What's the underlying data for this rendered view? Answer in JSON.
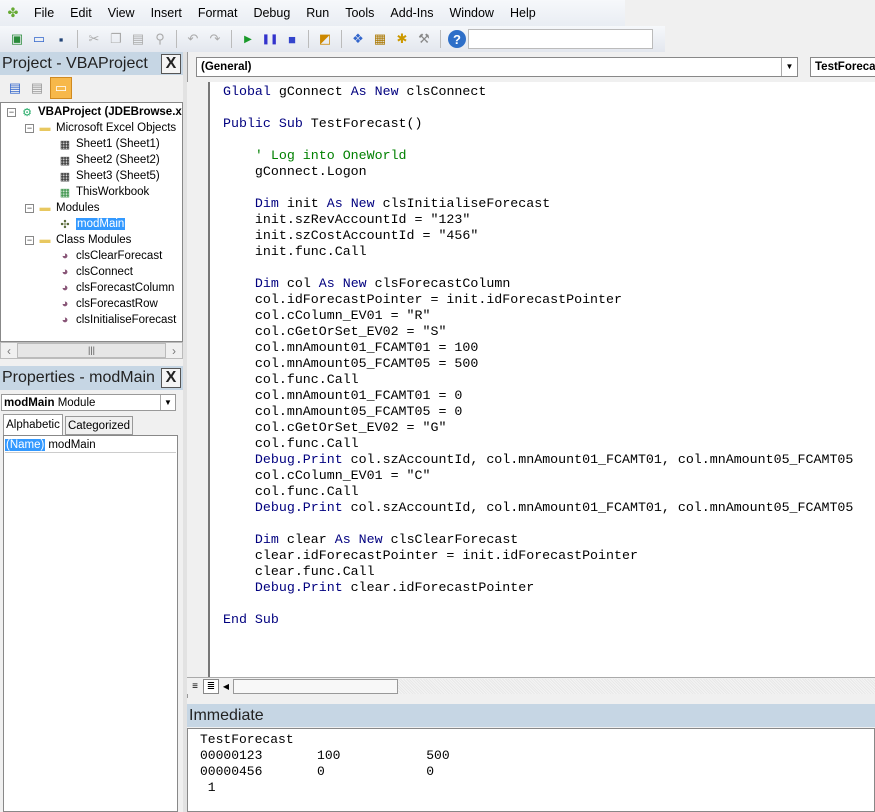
{
  "menu": [
    "File",
    "Edit",
    "View",
    "Insert",
    "Format",
    "Debug",
    "Run",
    "Tools",
    "Add-Ins",
    "Window",
    "Help"
  ],
  "toolbar_icons": [
    "excel-icon",
    "insert-userform-icon",
    "save-icon",
    "cut-icon",
    "copy-icon",
    "paste-icon",
    "find-icon",
    "undo-icon",
    "redo-icon",
    "run-icon",
    "break-icon",
    "reset-icon",
    "design-mode-icon",
    "project-explorer-icon",
    "properties-icon",
    "object-browser-icon",
    "toolbox-icon",
    "help-icon"
  ],
  "project": {
    "title": "Project - VBAProject",
    "close": "X",
    "tree": [
      {
        "label": "VBAProject (JDEBrowse.x",
        "level": 0,
        "icon": "vbaproject-icon",
        "bold": true
      },
      {
        "label": "Microsoft Excel Objects",
        "level": 1,
        "icon": "folder-icon"
      },
      {
        "label": "Sheet1 (Sheet1)",
        "level": 2,
        "icon": "sheet-icon"
      },
      {
        "label": "Sheet2 (Sheet2)",
        "level": 2,
        "icon": "sheet-icon"
      },
      {
        "label": "Sheet3 (Sheet5)",
        "level": 2,
        "icon": "sheet-icon"
      },
      {
        "label": "ThisWorkbook",
        "level": 2,
        "icon": "workbook-icon"
      },
      {
        "label": "Modules",
        "level": 1,
        "icon": "folder-icon"
      },
      {
        "label": "modMain",
        "level": 2,
        "icon": "module-icon",
        "selected": true
      },
      {
        "label": "Class Modules",
        "level": 1,
        "icon": "folder-icon"
      },
      {
        "label": "clsClearForecast",
        "level": 2,
        "icon": "class-module-icon"
      },
      {
        "label": "clsConnect",
        "level": 2,
        "icon": "class-module-icon"
      },
      {
        "label": "clsForecastColumn",
        "level": 2,
        "icon": "class-module-icon"
      },
      {
        "label": "clsForecastRow",
        "level": 2,
        "icon": "class-module-icon"
      },
      {
        "label": "clsInitialiseForecast",
        "level": 2,
        "icon": "class-module-icon"
      }
    ]
  },
  "properties": {
    "title": "Properties - modMain",
    "close": "X",
    "object_name": "modMain",
    "object_type": "Module",
    "tabs": [
      "Alphabetic",
      "Categorized"
    ],
    "rows": [
      {
        "name": "(Name)",
        "value": "modMain"
      }
    ]
  },
  "code_window": {
    "object_combo": "(General)",
    "proc_combo": "TestForecast",
    "lines": [
      [
        [
          "kw",
          "Global"
        ],
        [
          "tx",
          " gConnect "
        ],
        [
          "kw",
          "As New"
        ],
        [
          "tx",
          " clsConnect"
        ]
      ],
      [],
      [
        [
          "kw",
          "Public Sub"
        ],
        [
          "tx",
          " TestForecast()"
        ]
      ],
      [],
      [
        [
          "tx",
          "    "
        ],
        [
          "cm",
          "' Log into OneWorld"
        ]
      ],
      [
        [
          "tx",
          "    gConnect.Logon"
        ]
      ],
      [],
      [
        [
          "tx",
          "    "
        ],
        [
          "kw",
          "Dim"
        ],
        [
          "tx",
          " init "
        ],
        [
          "kw",
          "As New"
        ],
        [
          "tx",
          " clsInitialiseForecast"
        ]
      ],
      [
        [
          "tx",
          "    init.szRevAccountId = \"123\""
        ]
      ],
      [
        [
          "tx",
          "    init.szCostAccountId = \"456\""
        ]
      ],
      [
        [
          "tx",
          "    init.func.Call"
        ]
      ],
      [],
      [
        [
          "tx",
          "    "
        ],
        [
          "kw",
          "Dim"
        ],
        [
          "tx",
          " col "
        ],
        [
          "kw",
          "As New"
        ],
        [
          "tx",
          " clsForecastColumn"
        ]
      ],
      [
        [
          "tx",
          "    col.idForecastPointer = init.idForecastPointer"
        ]
      ],
      [
        [
          "tx",
          "    col.cColumn_EV01 = \"R\""
        ]
      ],
      [
        [
          "tx",
          "    col.cGetOrSet_EV02 = \"S\""
        ]
      ],
      [
        [
          "tx",
          "    col.mnAmount01_FCAMT01 = 100"
        ]
      ],
      [
        [
          "tx",
          "    col.mnAmount05_FCAMT05 = 500"
        ]
      ],
      [
        [
          "tx",
          "    col.func.Call"
        ]
      ],
      [
        [
          "tx",
          "    col.mnAmount01_FCAMT01 = 0"
        ]
      ],
      [
        [
          "tx",
          "    col.mnAmount05_FCAMT05 = 0"
        ]
      ],
      [
        [
          "tx",
          "    col.cGetOrSet_EV02 = \"G\""
        ]
      ],
      [
        [
          "tx",
          "    col.func.Call"
        ]
      ],
      [
        [
          "tx",
          "    "
        ],
        [
          "kw",
          "Debug.Print"
        ],
        [
          "tx",
          " col.szAccountId, col.mnAmount01_FCAMT01, col.mnAmount05_FCAMT05"
        ]
      ],
      [
        [
          "tx",
          "    col.cColumn_EV01 = \"C\""
        ]
      ],
      [
        [
          "tx",
          "    col.func.Call"
        ]
      ],
      [
        [
          "tx",
          "    "
        ],
        [
          "kw",
          "Debug.Print"
        ],
        [
          "tx",
          " col.szAccountId, col.mnAmount01_FCAMT01, col.mnAmount05_FCAMT05"
        ]
      ],
      [],
      [
        [
          "tx",
          "    "
        ],
        [
          "kw",
          "Dim"
        ],
        [
          "tx",
          " clear "
        ],
        [
          "kw",
          "As New"
        ],
        [
          "tx",
          " clsClearForecast"
        ]
      ],
      [
        [
          "tx",
          "    clear.idForecastPointer = init.idForecastPointer"
        ]
      ],
      [
        [
          "tx",
          "    clear.func.Call"
        ]
      ],
      [
        [
          "tx",
          "    "
        ],
        [
          "kw",
          "Debug.Print"
        ],
        [
          "tx",
          " clear.idForecastPointer"
        ]
      ],
      [],
      [
        [
          "kw",
          "End Sub"
        ]
      ]
    ]
  },
  "immediate": {
    "title": "Immediate",
    "lines": [
      "TestForecast",
      "00000123       100           500",
      "00000456       0             0",
      " 1"
    ]
  },
  "colors": {
    "keyword": "#00007f",
    "comment": "#008000",
    "selection": "#3399ff",
    "title_bar": "#c6d6e4"
  }
}
